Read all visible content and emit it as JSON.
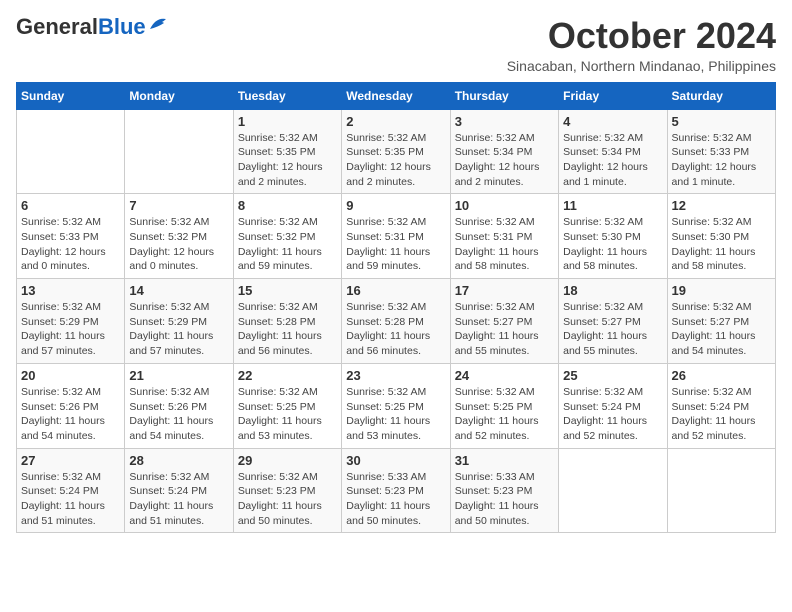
{
  "logo": {
    "general": "General",
    "blue": "Blue"
  },
  "header": {
    "month": "October 2024",
    "location": "Sinacaban, Northern Mindanao, Philippines"
  },
  "weekdays": [
    "Sunday",
    "Monday",
    "Tuesday",
    "Wednesday",
    "Thursday",
    "Friday",
    "Saturday"
  ],
  "weeks": [
    [
      {
        "day": "",
        "info": ""
      },
      {
        "day": "",
        "info": ""
      },
      {
        "day": "1",
        "info": "Sunrise: 5:32 AM\nSunset: 5:35 PM\nDaylight: 12 hours and 2 minutes."
      },
      {
        "day": "2",
        "info": "Sunrise: 5:32 AM\nSunset: 5:35 PM\nDaylight: 12 hours and 2 minutes."
      },
      {
        "day": "3",
        "info": "Sunrise: 5:32 AM\nSunset: 5:34 PM\nDaylight: 12 hours and 2 minutes."
      },
      {
        "day": "4",
        "info": "Sunrise: 5:32 AM\nSunset: 5:34 PM\nDaylight: 12 hours and 1 minute."
      },
      {
        "day": "5",
        "info": "Sunrise: 5:32 AM\nSunset: 5:33 PM\nDaylight: 12 hours and 1 minute."
      }
    ],
    [
      {
        "day": "6",
        "info": "Sunrise: 5:32 AM\nSunset: 5:33 PM\nDaylight: 12 hours and 0 minutes."
      },
      {
        "day": "7",
        "info": "Sunrise: 5:32 AM\nSunset: 5:32 PM\nDaylight: 12 hours and 0 minutes."
      },
      {
        "day": "8",
        "info": "Sunrise: 5:32 AM\nSunset: 5:32 PM\nDaylight: 11 hours and 59 minutes."
      },
      {
        "day": "9",
        "info": "Sunrise: 5:32 AM\nSunset: 5:31 PM\nDaylight: 11 hours and 59 minutes."
      },
      {
        "day": "10",
        "info": "Sunrise: 5:32 AM\nSunset: 5:31 PM\nDaylight: 11 hours and 58 minutes."
      },
      {
        "day": "11",
        "info": "Sunrise: 5:32 AM\nSunset: 5:30 PM\nDaylight: 11 hours and 58 minutes."
      },
      {
        "day": "12",
        "info": "Sunrise: 5:32 AM\nSunset: 5:30 PM\nDaylight: 11 hours and 58 minutes."
      }
    ],
    [
      {
        "day": "13",
        "info": "Sunrise: 5:32 AM\nSunset: 5:29 PM\nDaylight: 11 hours and 57 minutes."
      },
      {
        "day": "14",
        "info": "Sunrise: 5:32 AM\nSunset: 5:29 PM\nDaylight: 11 hours and 57 minutes."
      },
      {
        "day": "15",
        "info": "Sunrise: 5:32 AM\nSunset: 5:28 PM\nDaylight: 11 hours and 56 minutes."
      },
      {
        "day": "16",
        "info": "Sunrise: 5:32 AM\nSunset: 5:28 PM\nDaylight: 11 hours and 56 minutes."
      },
      {
        "day": "17",
        "info": "Sunrise: 5:32 AM\nSunset: 5:27 PM\nDaylight: 11 hours and 55 minutes."
      },
      {
        "day": "18",
        "info": "Sunrise: 5:32 AM\nSunset: 5:27 PM\nDaylight: 11 hours and 55 minutes."
      },
      {
        "day": "19",
        "info": "Sunrise: 5:32 AM\nSunset: 5:27 PM\nDaylight: 11 hours and 54 minutes."
      }
    ],
    [
      {
        "day": "20",
        "info": "Sunrise: 5:32 AM\nSunset: 5:26 PM\nDaylight: 11 hours and 54 minutes."
      },
      {
        "day": "21",
        "info": "Sunrise: 5:32 AM\nSunset: 5:26 PM\nDaylight: 11 hours and 54 minutes."
      },
      {
        "day": "22",
        "info": "Sunrise: 5:32 AM\nSunset: 5:25 PM\nDaylight: 11 hours and 53 minutes."
      },
      {
        "day": "23",
        "info": "Sunrise: 5:32 AM\nSunset: 5:25 PM\nDaylight: 11 hours and 53 minutes."
      },
      {
        "day": "24",
        "info": "Sunrise: 5:32 AM\nSunset: 5:25 PM\nDaylight: 11 hours and 52 minutes."
      },
      {
        "day": "25",
        "info": "Sunrise: 5:32 AM\nSunset: 5:24 PM\nDaylight: 11 hours and 52 minutes."
      },
      {
        "day": "26",
        "info": "Sunrise: 5:32 AM\nSunset: 5:24 PM\nDaylight: 11 hours and 52 minutes."
      }
    ],
    [
      {
        "day": "27",
        "info": "Sunrise: 5:32 AM\nSunset: 5:24 PM\nDaylight: 11 hours and 51 minutes."
      },
      {
        "day": "28",
        "info": "Sunrise: 5:32 AM\nSunset: 5:24 PM\nDaylight: 11 hours and 51 minutes."
      },
      {
        "day": "29",
        "info": "Sunrise: 5:32 AM\nSunset: 5:23 PM\nDaylight: 11 hours and 50 minutes."
      },
      {
        "day": "30",
        "info": "Sunrise: 5:33 AM\nSunset: 5:23 PM\nDaylight: 11 hours and 50 minutes."
      },
      {
        "day": "31",
        "info": "Sunrise: 5:33 AM\nSunset: 5:23 PM\nDaylight: 11 hours and 50 minutes."
      },
      {
        "day": "",
        "info": ""
      },
      {
        "day": "",
        "info": ""
      }
    ]
  ]
}
